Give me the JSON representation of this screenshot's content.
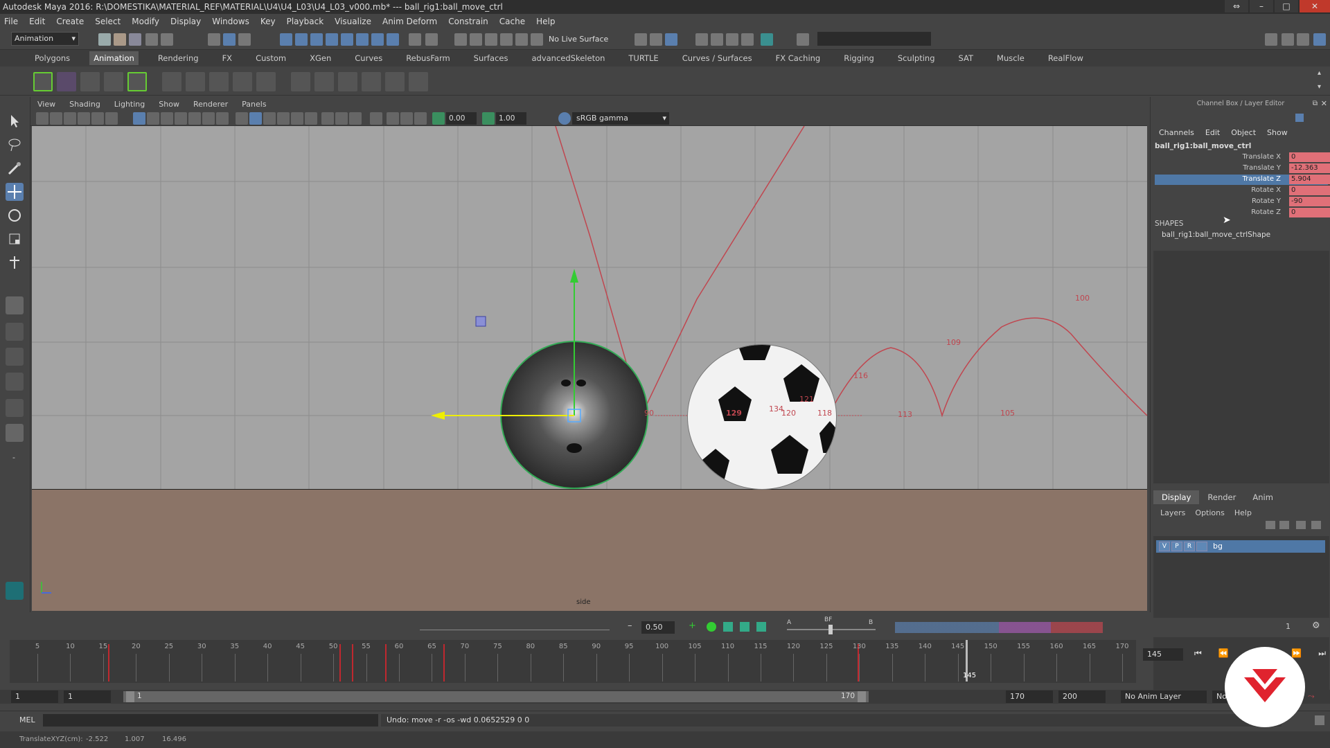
{
  "window": {
    "title": "Autodesk Maya 2016: R:\\DOMESTIKA\\MATERIAL_REF\\MATERIAL\\U4\\U4_L03\\U4_L03_v000.mb*  ---  ball_rig1:ball_move_ctrl"
  },
  "menus": [
    "File",
    "Edit",
    "Create",
    "Select",
    "Modify",
    "Display",
    "Windows",
    "Key",
    "Playback",
    "Visualize",
    "Anim Deform",
    "Constrain",
    "Cache",
    "Help"
  ],
  "status_line": {
    "mode": "Animation",
    "live_surface": "No Live Surface"
  },
  "shelf_tabs": [
    "Polygons",
    "Animation",
    "Rendering",
    "FX",
    "Custom",
    "XGen",
    "Curves",
    "RebusFarm",
    "Surfaces",
    "advancedSkeleton",
    "TURTLE",
    "Curves / Surfaces",
    "FX Caching",
    "Rigging",
    "Sculpting",
    "SAT",
    "Muscle",
    "RealFlow"
  ],
  "shelf_active": "Animation",
  "panel_menus": [
    "View",
    "Shading",
    "Lighting",
    "Show",
    "Renderer",
    "Panels"
  ],
  "panel_toolbar": {
    "exposure": "0.00",
    "gamma": "1.00",
    "color_space": "sRGB gamma"
  },
  "viewport": {
    "camera_label": "side",
    "trajectory_labels": [
      "100",
      "109",
      "116",
      "113",
      "105",
      "129",
      "134",
      "121",
      "118",
      "120",
      "90"
    ]
  },
  "channel_box": {
    "title": "Channel Box / Layer Editor",
    "menus": [
      "Channels",
      "Edit",
      "Object",
      "Show"
    ],
    "object": "ball_rig1:ball_move_ctrl",
    "attributes": [
      {
        "label": "Translate X",
        "value": "0"
      },
      {
        "label": "Translate Y",
        "value": "-12.363"
      },
      {
        "label": "Translate Z",
        "value": "5.904"
      },
      {
        "label": "Rotate X",
        "value": "0"
      },
      {
        "label": "Rotate Y",
        "value": "-90"
      },
      {
        "label": "Rotate Z",
        "value": "0"
      }
    ],
    "selected_attribute": "Translate Z",
    "shapes_label": "SHAPES",
    "shape_name": "ball_rig1:ball_move_ctrlShape"
  },
  "layer_editor": {
    "tabs": [
      "Display",
      "Render",
      "Anim"
    ],
    "menus": [
      "Layers",
      "Options",
      "Help"
    ],
    "layer": {
      "v": "V",
      "p": "P",
      "r": "R",
      "name": "bg"
    }
  },
  "anim_toolbar": {
    "value": "0.50",
    "label_a": "A",
    "label_bf": "BF",
    "label_b": "B",
    "page": "1"
  },
  "timeline": {
    "tick_labels": [
      "5",
      "10",
      "15",
      "20",
      "25",
      "30",
      "35",
      "40",
      "45",
      "50",
      "55",
      "60",
      "65",
      "70",
      "75",
      "80",
      "85",
      "90",
      "95",
      "100",
      "105",
      "110",
      "115",
      "120",
      "125",
      "130",
      "135",
      "140",
      "145",
      "150",
      "155",
      "160",
      "165",
      "170"
    ],
    "current_frame": "145",
    "current_frame_field": "145"
  },
  "range": {
    "start": "1",
    "playback_start": "1",
    "slider_start": "1",
    "slider_end": "170",
    "playback_end": "170",
    "end": "200",
    "anim_layer": "No Anim Layer",
    "char_set": "No"
  },
  "command_line": {
    "mel_label": "MEL",
    "result": "Undo: move -r -os -wd 0.0652529 0 0"
  },
  "help_line": {
    "label": "TranslateXYZ(cm):",
    "x": "-2.522",
    "y": "1.007",
    "z": "16.496"
  }
}
